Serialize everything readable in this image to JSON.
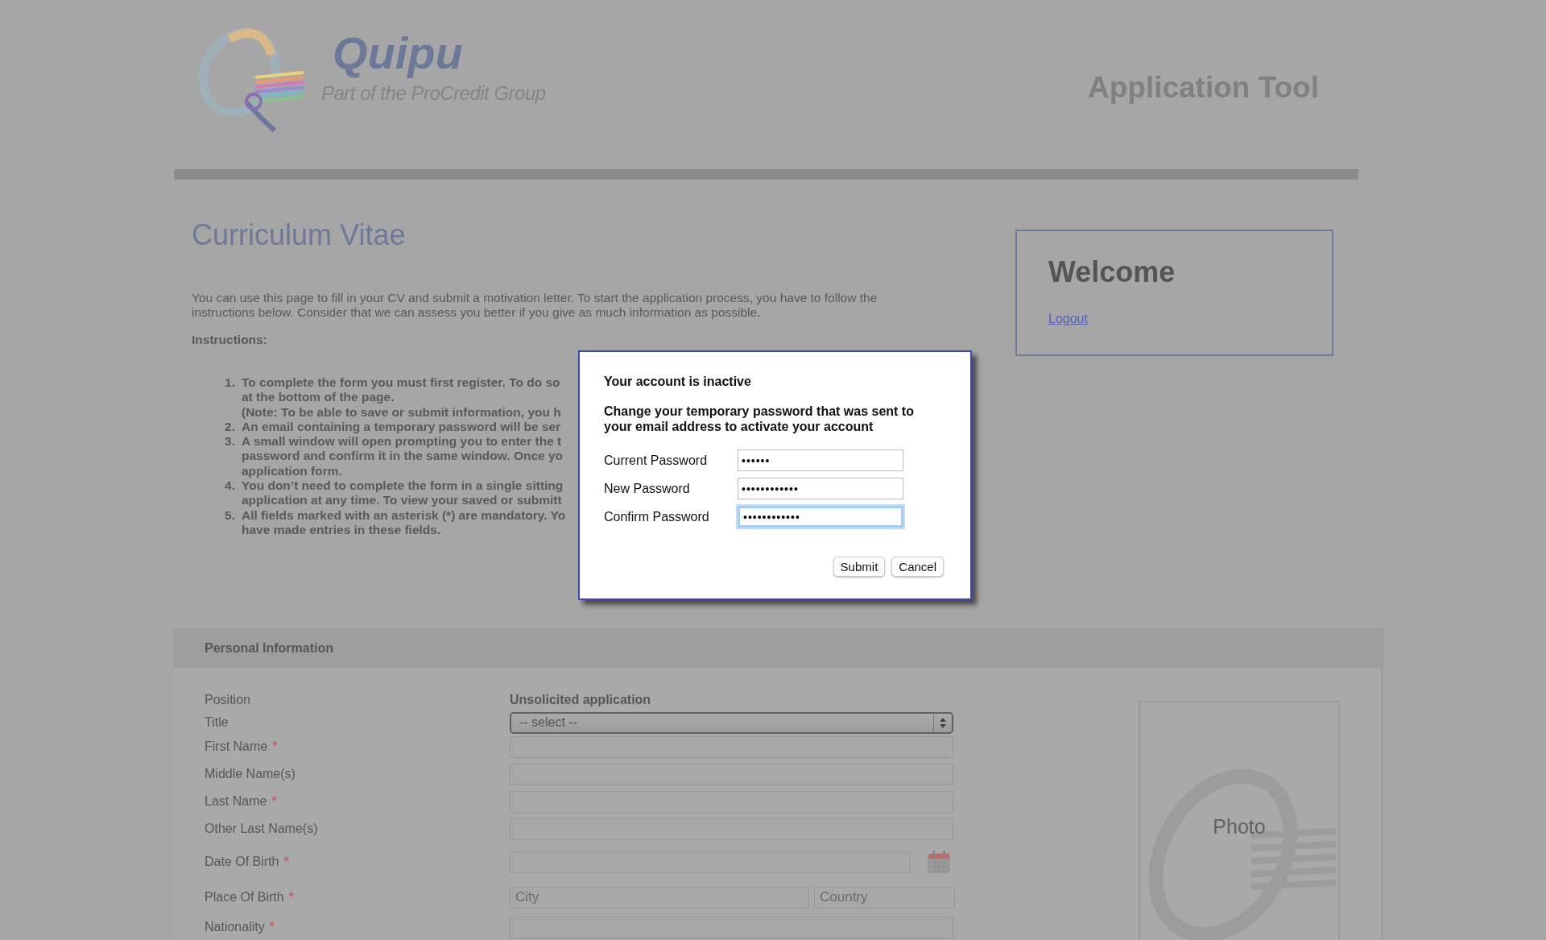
{
  "header": {
    "brand": "Quipu",
    "tagline": "Part of the ProCredit Group",
    "app_title": "Application Tool"
  },
  "page": {
    "title": "Curriculum Vitae",
    "intro": "You can use this page to fill in your CV and submit a motivation letter. To start the application process, you have to follow the instructions below. Consider that we can assess you better if you give as much information as possible.",
    "instructions_heading": "Instructions:",
    "instructions": [
      {
        "number": "1.",
        "lines": [
          "To complete the form you must first register. To do so",
          "at the bottom of the page.",
          "(Note: To be able to save or submit information, you h"
        ]
      },
      {
        "number": "2.",
        "lines": [
          "An email containing a temporary password will be ser"
        ]
      },
      {
        "number": "3.",
        "lines": [
          "A small window will open prompting you to enter the t",
          "password and confirm it in the same window. Once yo",
          "application form."
        ]
      },
      {
        "number": "4.",
        "lines": [
          "You don’t need to complete the form in a single sitting",
          "application at any time. To view your saved or submitt"
        ]
      },
      {
        "number": "5.",
        "lines": [
          "All fields marked with an asterisk (*) are mandatory. Yo",
          "have made entries in these fields."
        ]
      }
    ]
  },
  "welcome": {
    "title": "Welcome",
    "link": "Logout"
  },
  "personal_information": {
    "title": "Personal Information",
    "photo_label": "Photo",
    "rows": [
      {
        "kind": "static",
        "label": "Position",
        "value": "Unsolicited application"
      },
      {
        "kind": "select",
        "label": "Title",
        "value": "-- select --"
      },
      {
        "kind": "text",
        "label": "First Name",
        "required_mark": "*"
      },
      {
        "kind": "text",
        "label": "Middle Name(s)"
      },
      {
        "kind": "text",
        "label": "Last Name",
        "required_mark": "*"
      },
      {
        "kind": "text",
        "label": "Other Last Name(s)"
      },
      {
        "kind": "date",
        "label": "Date Of Birth",
        "required_mark": "*"
      },
      {
        "kind": "place",
        "label": "Place Of Birth",
        "required_mark": "*",
        "placeholders": [
          "City",
          "Country"
        ]
      },
      {
        "kind": "text",
        "label": "Nationality",
        "required_mark": "*"
      }
    ]
  },
  "dialog": {
    "title": "Your account is inactive",
    "message": "Change your temporary password that was sent to your email address to activate your account",
    "fields": [
      {
        "label": "Current Password",
        "value": "••••••",
        "focused": false
      },
      {
        "label": "New Password",
        "value": "••••••••••••",
        "focused": false
      },
      {
        "label": "Confirm Password",
        "value": "••••••••••••",
        "focused": true
      }
    ],
    "buttons": [
      "Submit",
      "Cancel"
    ]
  }
}
